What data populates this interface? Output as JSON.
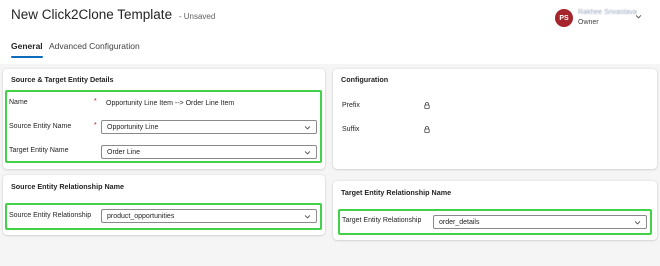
{
  "header": {
    "title": "New Click2Clone Template",
    "status": "- Unsaved",
    "tabs": [
      "General",
      "Advanced Configuration"
    ],
    "user": {
      "initials": "PS",
      "name": "Rakhee Srivastava",
      "role": "Owner"
    }
  },
  "source_target": {
    "title": "Source & Target Entity Details",
    "name_label": "Name",
    "name_value": "Opportunity Line Item --> Order Line Item",
    "source_label": "Source Entity Name",
    "source_value": "Opportunity Line",
    "target_label": "Target Entity Name",
    "target_value": "Order Line",
    "required_mark": "*"
  },
  "configuration": {
    "title": "Configuration",
    "prefix_label": "Prefix",
    "suffix_label": "Suffix"
  },
  "source_relationship": {
    "title": "Source Entity Relationship Name",
    "label": "Source Entity Relationship",
    "value": "product_opportunities"
  },
  "target_relationship": {
    "title": "Target Entity Relationship Name",
    "label": "Target Entity Relationship",
    "value": "order_details"
  },
  "colors": {
    "highlight": "#44d14a",
    "accent": "#0f6cbd",
    "avatar": "#a4262c",
    "required": "#c50f1f"
  },
  "icons": [
    "chevron-down-icon",
    "lock-icon"
  ]
}
